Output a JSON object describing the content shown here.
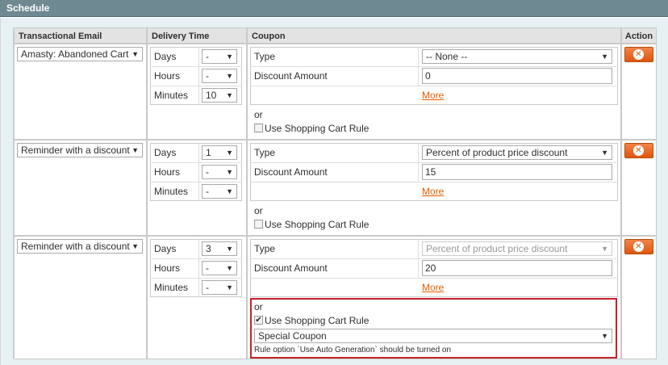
{
  "section_title": "Schedule",
  "columns": {
    "email": "Transactional Email",
    "delivery": "Delivery Time",
    "coupon": "Coupon",
    "action": "Action"
  },
  "labels": {
    "days": "Days",
    "hours": "Hours",
    "minutes": "Minutes",
    "type": "Type",
    "discount_amount": "Discount Amount",
    "more": "More",
    "or": "or",
    "use_cart_rule": "Use Shopping Cart Rule"
  },
  "rows": [
    {
      "email": "Amasty: Abandoned Cart",
      "days": "-",
      "hours": "-",
      "minutes": "10",
      "type": "-- None --",
      "type_disabled": false,
      "discount": "0",
      "use_cart_rule": false
    },
    {
      "email": "Reminder with a discount",
      "days": "1",
      "hours": "-",
      "minutes": "-",
      "type": "Percent of product price discount",
      "type_disabled": false,
      "discount": "15",
      "use_cart_rule": false
    },
    {
      "email": "Reminder with a discount",
      "days": "3",
      "hours": "-",
      "minutes": "-",
      "type": "Percent of product price discount",
      "type_disabled": true,
      "discount": "20",
      "use_cart_rule": true,
      "cart_rule": "Special Coupon",
      "cart_rule_note": "Rule option `Use Auto Generation` should be turned on"
    }
  ],
  "icons": {
    "delete": "delete-circle-x-icon",
    "dropdown": "dropdown-arrow-icon"
  },
  "colors": {
    "header": "#6f8992",
    "link": "#eb5e00",
    "delete_button": "#e0560e",
    "highlight": "#c8202a"
  }
}
